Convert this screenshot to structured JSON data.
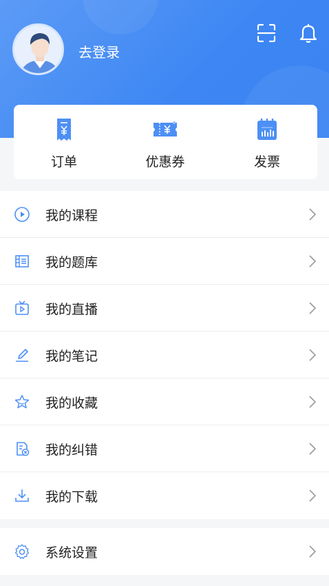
{
  "header": {
    "login_text": "去登录"
  },
  "quick_actions": [
    {
      "label": "订单",
      "icon": "receipt-icon"
    },
    {
      "label": "优惠券",
      "icon": "coupon-icon"
    },
    {
      "label": "发票",
      "icon": "invoice-icon"
    }
  ],
  "menu": [
    {
      "label": "我的课程",
      "icon": "play-circle-icon"
    },
    {
      "label": "我的题库",
      "icon": "question-bank-icon"
    },
    {
      "label": "我的直播",
      "icon": "tv-live-icon"
    },
    {
      "label": "我的笔记",
      "icon": "pen-icon"
    },
    {
      "label": "我的收藏",
      "icon": "star-icon"
    },
    {
      "label": "我的纠错",
      "icon": "error-report-icon"
    },
    {
      "label": "我的下载",
      "icon": "download-icon"
    }
  ],
  "settings": {
    "label": "系统设置",
    "icon": "gear-icon"
  },
  "colors": {
    "brand_blue": "#3d86f3",
    "icon_blue": "#4d8ff5",
    "text": "#222222"
  }
}
